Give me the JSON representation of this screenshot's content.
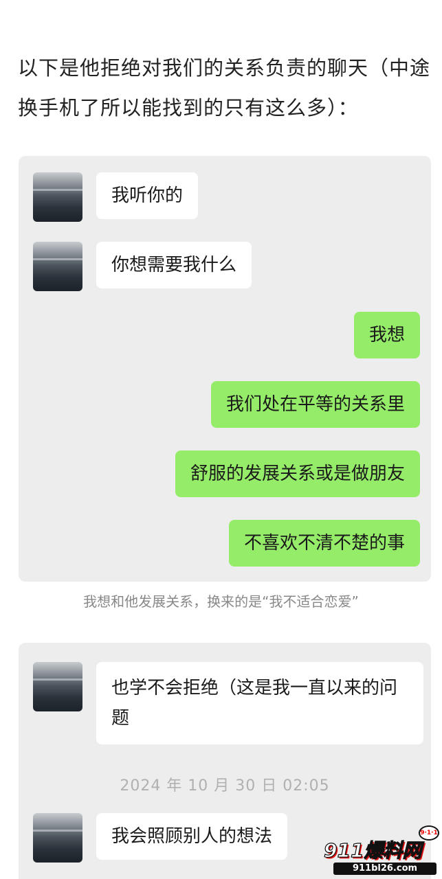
{
  "intro": "以下是他拒绝对我们的关系负责的聊天（中途换手机了所以能找到的只有这么多）：",
  "chat1": {
    "messages": [
      {
        "side": "in",
        "text": "我听你的"
      },
      {
        "side": "in",
        "text": "你想需要我什么"
      },
      {
        "side": "out",
        "text": "我想"
      },
      {
        "side": "out",
        "text": "我们处在平等的关系里"
      },
      {
        "side": "out",
        "text": "舒服的发展关系或是做朋友"
      },
      {
        "side": "out",
        "text": "不喜欢不清不楚的事"
      }
    ]
  },
  "caption": "我想和他发展关系，换来的是“我不适合恋爱”",
  "chat2": {
    "messages": [
      {
        "side": "in",
        "text": "也学不会拒绝（这是我一直以来的问题"
      },
      {
        "side": "in",
        "text": "我会照顾别人的想法"
      }
    ],
    "timestamp": "2024 年 10 月 30 日 02:05"
  },
  "watermark": {
    "badge": "9·1·1",
    "main": "911爆料网",
    "url": "911bl26.com"
  },
  "colors": {
    "incoming_bubble": "#ffffff",
    "outgoing_bubble": "#95ec69",
    "chat_background": "#ededed"
  }
}
